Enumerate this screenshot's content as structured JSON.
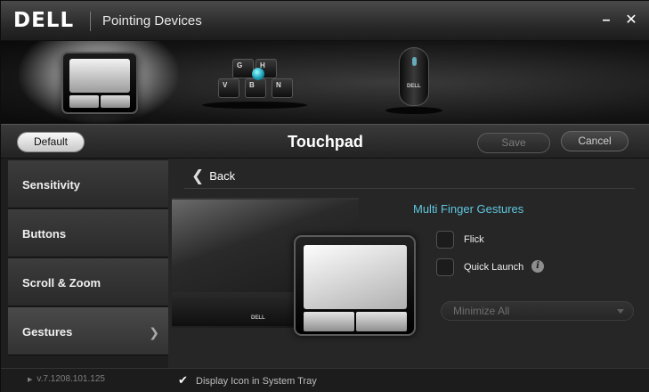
{
  "titlebar": {
    "brand": "DELL",
    "title": "Pointing Devices",
    "minimize": "–",
    "close": "✕"
  },
  "devices": {
    "keyboard_keys": [
      "G",
      "H",
      "V",
      "B",
      "N"
    ],
    "mouse_brand": "DELL"
  },
  "header": {
    "default_label": "Default",
    "title": "Touchpad",
    "save_label": "Save",
    "cancel_label": "Cancel"
  },
  "sidebar": {
    "items": [
      {
        "label": "Sensitivity"
      },
      {
        "label": "Buttons"
      },
      {
        "label": "Scroll & Zoom"
      },
      {
        "label": "Gestures"
      }
    ]
  },
  "main": {
    "back_label": "Back",
    "laptop_brand": "DELL",
    "section_title": "Multi Finger Gestures",
    "options": [
      {
        "label": "Flick",
        "checked": false
      },
      {
        "label": "Quick Launch",
        "checked": false
      }
    ],
    "dropdown_value": "Minimize All"
  },
  "footer": {
    "version": "v.7.1208.101.125",
    "tray_label": "Display Icon in System Tray",
    "tray_checked": true
  },
  "colors": {
    "accent": "#5fc7df",
    "trackpoint": "#1a9fb8"
  }
}
